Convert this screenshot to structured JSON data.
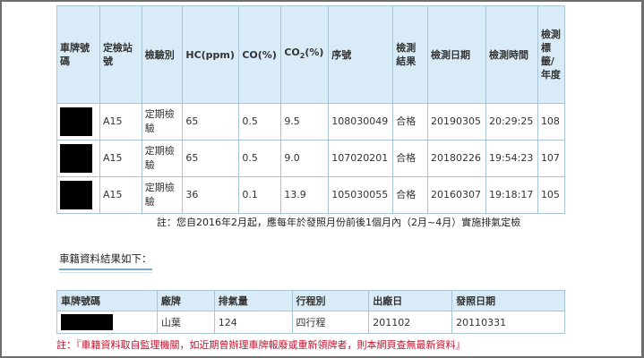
{
  "inspection": {
    "headers": {
      "plate": "車牌號碼",
      "station": "定檢站號",
      "type": "檢驗別",
      "hc": "HC(ppm)",
      "co": "CO(%)",
      "co2_prefix": "CO",
      "co2_sub": "2",
      "co2_suffix": "(%)",
      "serial": "序號",
      "result": "檢測結果",
      "date": "檢測日期",
      "time": "檢測時間",
      "label_year": "檢測標籤/年度"
    },
    "rows": [
      {
        "station": "A15",
        "type": "定期檢驗",
        "hc": "65",
        "co": "0.5",
        "co2": "9.5",
        "serial": "108030049",
        "result": "合格",
        "date": "20190305",
        "time": "20:29:25",
        "year": "108"
      },
      {
        "station": "A15",
        "type": "定期檢驗",
        "hc": "65",
        "co": "0.5",
        "co2": "9.0",
        "serial": "107020201",
        "result": "合格",
        "date": "20180226",
        "time": "19:54:23",
        "year": "107"
      },
      {
        "station": "A15",
        "type": "定期檢驗",
        "hc": "36",
        "co": "0.1",
        "co2": "13.9",
        "serial": "105030055",
        "result": "合格",
        "date": "20160307",
        "time": "19:18:17",
        "year": "105"
      }
    ],
    "note": "註：您自2016年2月起，應每年於發照月份前後1個月內（2月~4月）實施排氣定檢"
  },
  "vehicle": {
    "section_title": "車籍資料結果如下：",
    "headers": {
      "plate": "車牌號碼",
      "brand": "廠牌",
      "displacement": "排氣量",
      "stroke": "行程別",
      "factory_date": "出廠日",
      "issue_date": "發照日期"
    },
    "row": {
      "brand": "山葉",
      "displacement": "124",
      "stroke": "四行程",
      "factory_date": "201102",
      "issue_date": "20110331"
    },
    "note": "註：『車籍資料取自監理機關，如近期曾辦理車牌報廢或重新領牌者，則本網頁查無最新資料』"
  },
  "colors": {
    "header_bg": "#d9ebf6",
    "border": "#a9c4d6",
    "note_red": "#c8102e"
  }
}
